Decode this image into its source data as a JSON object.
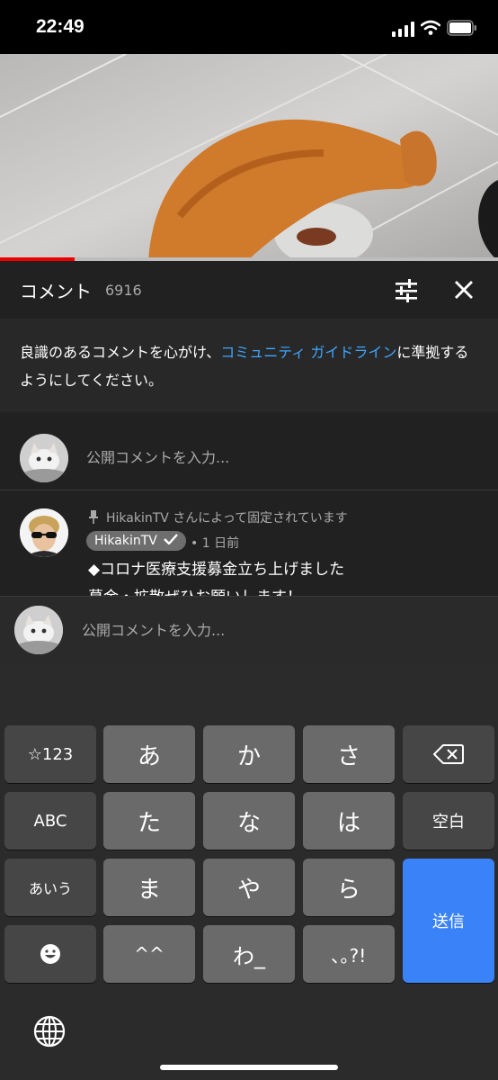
{
  "status_bar": {
    "time": "22:49"
  },
  "video": {
    "progress_fraction": 0.15
  },
  "comments": {
    "title": "コメント",
    "count": "6916",
    "notice_before": "良識のあるコメントを心がけ、",
    "notice_link": "コミュニティ ガイドライン",
    "notice_after": "に準拠するようにしてください。",
    "add_placeholder": "公開コメントを入力..."
  },
  "pinned_comment": {
    "pinned_label": "HikakinTV さんによって固定されています",
    "author": "HikakinTV",
    "time": "• 1 日前",
    "text_line1": "◆コロナ医療支援募金立ち上げました",
    "text_line2": "募金・拡散ぜひお願いします！"
  },
  "composer": {
    "placeholder": "公開コメントを入力..."
  },
  "keyboard": {
    "row1": [
      "☆123",
      "あ",
      "か",
      "さ"
    ],
    "row2": [
      "ABC",
      "た",
      "な",
      "は",
      "空白"
    ],
    "row3": [
      "あいう",
      "ま",
      "や",
      "ら"
    ],
    "row4": [
      "^^",
      "わ_",
      "､｡?!"
    ],
    "send": "送信"
  },
  "colors": {
    "link": "#3ea6ff",
    "send_key": "#3a82f7",
    "progress": "#e00000"
  }
}
